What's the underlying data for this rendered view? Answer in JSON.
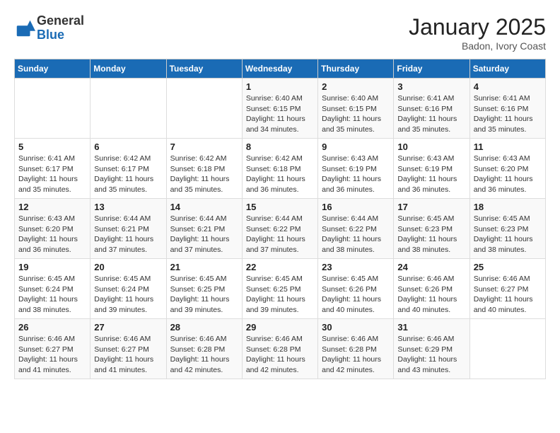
{
  "header": {
    "logo_general": "General",
    "logo_blue": "Blue",
    "month_title": "January 2025",
    "location": "Badon, Ivory Coast"
  },
  "days_of_week": [
    "Sunday",
    "Monday",
    "Tuesday",
    "Wednesday",
    "Thursday",
    "Friday",
    "Saturday"
  ],
  "weeks": [
    [
      {
        "day": "",
        "info": ""
      },
      {
        "day": "",
        "info": ""
      },
      {
        "day": "",
        "info": ""
      },
      {
        "day": "1",
        "info": "Sunrise: 6:40 AM\nSunset: 6:15 PM\nDaylight: 11 hours\nand 34 minutes."
      },
      {
        "day": "2",
        "info": "Sunrise: 6:40 AM\nSunset: 6:15 PM\nDaylight: 11 hours\nand 35 minutes."
      },
      {
        "day": "3",
        "info": "Sunrise: 6:41 AM\nSunset: 6:16 PM\nDaylight: 11 hours\nand 35 minutes."
      },
      {
        "day": "4",
        "info": "Sunrise: 6:41 AM\nSunset: 6:16 PM\nDaylight: 11 hours\nand 35 minutes."
      }
    ],
    [
      {
        "day": "5",
        "info": "Sunrise: 6:41 AM\nSunset: 6:17 PM\nDaylight: 11 hours\nand 35 minutes."
      },
      {
        "day": "6",
        "info": "Sunrise: 6:42 AM\nSunset: 6:17 PM\nDaylight: 11 hours\nand 35 minutes."
      },
      {
        "day": "7",
        "info": "Sunrise: 6:42 AM\nSunset: 6:18 PM\nDaylight: 11 hours\nand 35 minutes."
      },
      {
        "day": "8",
        "info": "Sunrise: 6:42 AM\nSunset: 6:18 PM\nDaylight: 11 hours\nand 36 minutes."
      },
      {
        "day": "9",
        "info": "Sunrise: 6:43 AM\nSunset: 6:19 PM\nDaylight: 11 hours\nand 36 minutes."
      },
      {
        "day": "10",
        "info": "Sunrise: 6:43 AM\nSunset: 6:19 PM\nDaylight: 11 hours\nand 36 minutes."
      },
      {
        "day": "11",
        "info": "Sunrise: 6:43 AM\nSunset: 6:20 PM\nDaylight: 11 hours\nand 36 minutes."
      }
    ],
    [
      {
        "day": "12",
        "info": "Sunrise: 6:43 AM\nSunset: 6:20 PM\nDaylight: 11 hours\nand 36 minutes."
      },
      {
        "day": "13",
        "info": "Sunrise: 6:44 AM\nSunset: 6:21 PM\nDaylight: 11 hours\nand 37 minutes."
      },
      {
        "day": "14",
        "info": "Sunrise: 6:44 AM\nSunset: 6:21 PM\nDaylight: 11 hours\nand 37 minutes."
      },
      {
        "day": "15",
        "info": "Sunrise: 6:44 AM\nSunset: 6:22 PM\nDaylight: 11 hours\nand 37 minutes."
      },
      {
        "day": "16",
        "info": "Sunrise: 6:44 AM\nSunset: 6:22 PM\nDaylight: 11 hours\nand 38 minutes."
      },
      {
        "day": "17",
        "info": "Sunrise: 6:45 AM\nSunset: 6:23 PM\nDaylight: 11 hours\nand 38 minutes."
      },
      {
        "day": "18",
        "info": "Sunrise: 6:45 AM\nSunset: 6:23 PM\nDaylight: 11 hours\nand 38 minutes."
      }
    ],
    [
      {
        "day": "19",
        "info": "Sunrise: 6:45 AM\nSunset: 6:24 PM\nDaylight: 11 hours\nand 38 minutes."
      },
      {
        "day": "20",
        "info": "Sunrise: 6:45 AM\nSunset: 6:24 PM\nDaylight: 11 hours\nand 39 minutes."
      },
      {
        "day": "21",
        "info": "Sunrise: 6:45 AM\nSunset: 6:25 PM\nDaylight: 11 hours\nand 39 minutes."
      },
      {
        "day": "22",
        "info": "Sunrise: 6:45 AM\nSunset: 6:25 PM\nDaylight: 11 hours\nand 39 minutes."
      },
      {
        "day": "23",
        "info": "Sunrise: 6:45 AM\nSunset: 6:26 PM\nDaylight: 11 hours\nand 40 minutes."
      },
      {
        "day": "24",
        "info": "Sunrise: 6:46 AM\nSunset: 6:26 PM\nDaylight: 11 hours\nand 40 minutes."
      },
      {
        "day": "25",
        "info": "Sunrise: 6:46 AM\nSunset: 6:27 PM\nDaylight: 11 hours\nand 40 minutes."
      }
    ],
    [
      {
        "day": "26",
        "info": "Sunrise: 6:46 AM\nSunset: 6:27 PM\nDaylight: 11 hours\nand 41 minutes."
      },
      {
        "day": "27",
        "info": "Sunrise: 6:46 AM\nSunset: 6:27 PM\nDaylight: 11 hours\nand 41 minutes."
      },
      {
        "day": "28",
        "info": "Sunrise: 6:46 AM\nSunset: 6:28 PM\nDaylight: 11 hours\nand 42 minutes."
      },
      {
        "day": "29",
        "info": "Sunrise: 6:46 AM\nSunset: 6:28 PM\nDaylight: 11 hours\nand 42 minutes."
      },
      {
        "day": "30",
        "info": "Sunrise: 6:46 AM\nSunset: 6:28 PM\nDaylight: 11 hours\nand 42 minutes."
      },
      {
        "day": "31",
        "info": "Sunrise: 6:46 AM\nSunset: 6:29 PM\nDaylight: 11 hours\nand 43 minutes."
      },
      {
        "day": "",
        "info": ""
      }
    ]
  ]
}
